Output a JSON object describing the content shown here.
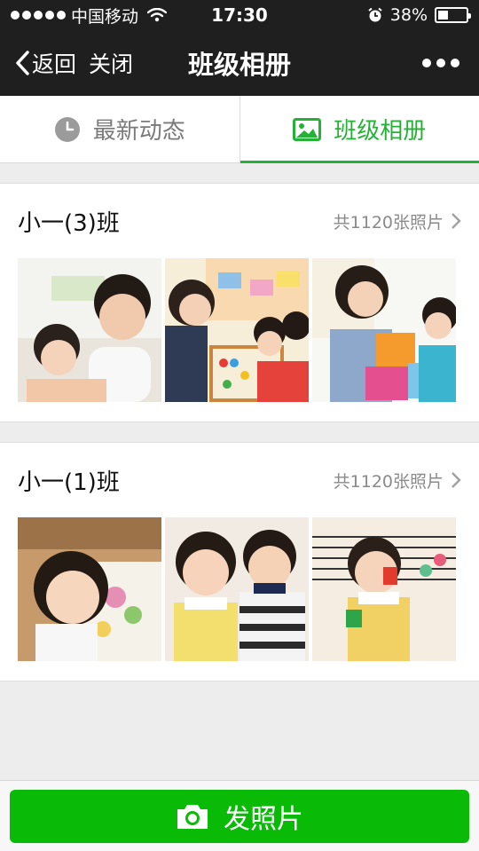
{
  "status_bar": {
    "carrier": "中国移动",
    "time": "17:30",
    "battery_percent": "38%",
    "battery_level": 0.38,
    "icons": [
      "signal-dots-icon",
      "wifi-icon",
      "alarm-icon",
      "battery-icon"
    ]
  },
  "nav": {
    "back_label": "返回",
    "close_label": "关闭",
    "title": "班级相册",
    "more_icon": "more-dots-icon"
  },
  "tabs": [
    {
      "label": "最新动态",
      "icon": "clock-icon",
      "active": false
    },
    {
      "label": "班级相册",
      "icon": "image-icon",
      "active": true
    }
  ],
  "albums": [
    {
      "name": "小一(3)班",
      "count_text": "共1120张照片"
    },
    {
      "name": "小一(1)班",
      "count_text": "共1120张照片"
    }
  ],
  "bottom": {
    "button_label": "发照片",
    "button_icon": "camera-icon"
  },
  "colors": {
    "accent": "#24b135",
    "button": "#09bb07",
    "header": "#1f1f20"
  }
}
